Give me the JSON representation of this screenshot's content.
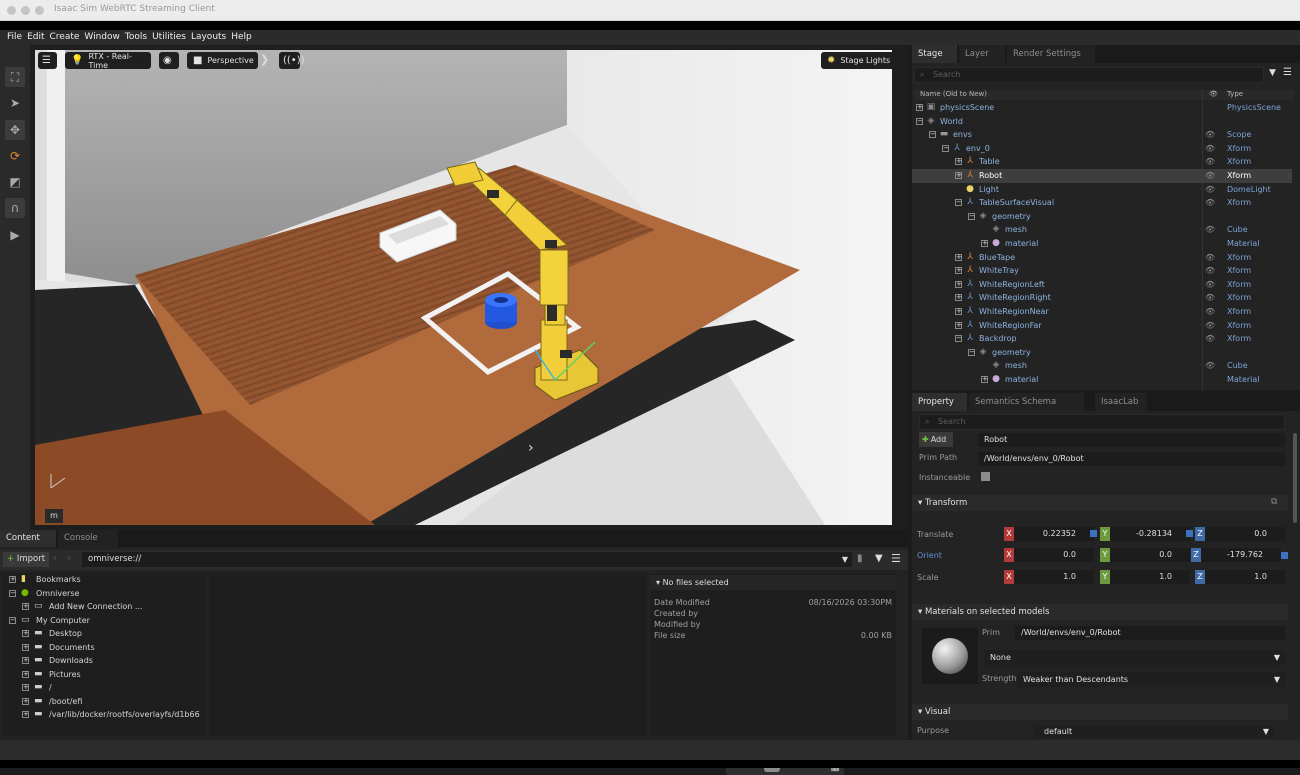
{
  "window": {
    "title": "Isaac Sim WebRTC Streaming Client"
  },
  "menu": [
    "File",
    "Edit",
    "Create",
    "Window",
    "Tools",
    "Utilities",
    "Layouts",
    "Help"
  ],
  "left_toolbar": [
    "select-all-icon",
    "pointer-icon",
    "move-icon",
    "rotate-icon",
    "scale-icon",
    "snap-icon",
    "play-icon"
  ],
  "viewport": {
    "render_mode": "RTX - Real-Time",
    "camera": "Perspective",
    "lights": "Stage Lights",
    "unit_label": "m"
  },
  "stage": {
    "tabs": [
      "Stage",
      "Layer",
      "Render Settings"
    ],
    "search_placeholder": "Search",
    "col_name": "Name (Old to New)",
    "col_type": "Type",
    "rows": [
      {
        "name": "physicsScene",
        "type": "PhysicsScene",
        "eye": "",
        "icon": "▣",
        "icolor": "#8a8a8a",
        "exp": "+"
      },
      {
        "name": "World",
        "type": "",
        "eye": "",
        "icon": "◈",
        "icolor": "#8a8a8a",
        "exp": "−"
      },
      {
        "name": "envs",
        "type": "Scope",
        "eye": "👁",
        "icon": "▬",
        "icolor": "#999",
        "exp": "−"
      },
      {
        "name": "env_0",
        "type": "Xform",
        "eye": "👁",
        "icon": "⅄",
        "icolor": "#6f9ad6",
        "exp": "−"
      },
      {
        "name": "Table",
        "type": "Xform",
        "eye": "👁",
        "icon": "⅄",
        "icolor": "#e3873a",
        "exp": "+"
      },
      {
        "name": "Robot",
        "type": "Xform",
        "eye": "👁",
        "icon": "⅄",
        "icolor": "#e3873a",
        "exp": "+"
      },
      {
        "name": "Light",
        "type": "DomeLight",
        "eye": "👁",
        "icon": "●",
        "icolor": "#e8d26a",
        "exp": ""
      },
      {
        "name": "TableSurfaceVisual",
        "type": "Xform",
        "eye": "👁",
        "icon": "⅄",
        "icolor": "#6f9ad6",
        "exp": "−"
      },
      {
        "name": "geometry",
        "type": "",
        "eye": "",
        "icon": "◈",
        "icolor": "#8a8a8a",
        "exp": "−"
      },
      {
        "name": "mesh",
        "type": "Cube",
        "eye": "👁",
        "icon": "◈",
        "icolor": "#8a8a8a",
        "exp": ""
      },
      {
        "name": "material",
        "type": "Material",
        "eye": "",
        "icon": "●",
        "icolor": "#c8a8d8",
        "exp": "+"
      },
      {
        "name": "BlueTape",
        "type": "Xform",
        "eye": "👁",
        "icon": "⅄",
        "icolor": "#e3873a",
        "exp": "+"
      },
      {
        "name": "WhiteTray",
        "type": "Xform",
        "eye": "👁",
        "icon": "⅄",
        "icolor": "#e3873a",
        "exp": "+"
      },
      {
        "name": "WhiteRegionLeft",
        "type": "Xform",
        "eye": "👁",
        "icon": "⅄",
        "icolor": "#6f9ad6",
        "exp": "+"
      },
      {
        "name": "WhiteRegionRight",
        "type": "Xform",
        "eye": "👁",
        "icon": "⅄",
        "icolor": "#6f9ad6",
        "exp": "+"
      },
      {
        "name": "WhiteRegionNear",
        "type": "Xform",
        "eye": "👁",
        "icon": "⅄",
        "icolor": "#6f9ad6",
        "exp": "+"
      },
      {
        "name": "WhiteRegionFar",
        "type": "Xform",
        "eye": "👁",
        "icon": "⅄",
        "icolor": "#6f9ad6",
        "exp": "+"
      },
      {
        "name": "Backdrop",
        "type": "Xform",
        "eye": "👁",
        "icon": "⅄",
        "icolor": "#6f9ad6",
        "exp": "−"
      },
      {
        "name": "geometry",
        "type": "",
        "eye": "",
        "icon": "◈",
        "icolor": "#8a8a8a",
        "exp": "−"
      },
      {
        "name": "mesh",
        "type": "Cube",
        "eye": "👁",
        "icon": "◈",
        "icolor": "#8a8a8a",
        "exp": ""
      },
      {
        "name": "material",
        "type": "Material",
        "eye": "",
        "icon": "●",
        "icolor": "#c8a8d8",
        "exp": "+"
      }
    ]
  },
  "property": {
    "tabs": [
      "Property",
      "Semantics Schema Editor",
      "IsaacLab"
    ],
    "search_placeholder": "Search",
    "add_label": "Add",
    "prim_name": "Robot",
    "prim_path_label": "Prim Path",
    "prim_path": "/World/envs/env_0/Robot",
    "instanceable_label": "Instanceable",
    "transform_title": "Transform",
    "translate_label": "Translate",
    "orient_label": "Orient",
    "scale_label": "Scale",
    "translate": [
      "0.22352",
      "-0.28134",
      "0.0"
    ],
    "orient": [
      "0.0",
      "0.0",
      "-179.762"
    ],
    "scale": [
      "1.0",
      "1.0",
      "1.0"
    ],
    "axes": [
      "X",
      "Y",
      "Z"
    ],
    "materials_title": "Materials on selected models",
    "mat_prim_label": "Prim",
    "mat_prim": "/World/envs/env_0/Robot",
    "mat_binding": "None",
    "strength_label": "Strength",
    "strength": "Weaker than Descendants",
    "visual_title": "Visual",
    "purpose_label": "Purpose",
    "purpose": "default"
  },
  "content": {
    "tabs": [
      "Content",
      "Console"
    ],
    "import_label": "Import",
    "path": "omniverse://",
    "tree": [
      {
        "name": "Bookmarks",
        "icon": "▮",
        "icolor": "#e8d26a",
        "exp": "+",
        "lvl": 0
      },
      {
        "name": "Omniverse",
        "icon": "●",
        "icolor": "#76b900",
        "exp": "−",
        "lvl": 0
      },
      {
        "name": "Add New Connection ...",
        "icon": "▭",
        "icolor": "#ccc",
        "exp": "+",
        "lvl": 1
      },
      {
        "name": "My Computer",
        "icon": "▭",
        "icolor": "#ccc",
        "exp": "−",
        "lvl": 0
      },
      {
        "name": "Desktop",
        "icon": "▬",
        "icolor": "#ccc",
        "exp": "+",
        "lvl": 1
      },
      {
        "name": "Documents",
        "icon": "▬",
        "icolor": "#ccc",
        "exp": "+",
        "lvl": 1
      },
      {
        "name": "Downloads",
        "icon": "▬",
        "icolor": "#ccc",
        "exp": "+",
        "lvl": 1
      },
      {
        "name": "Pictures",
        "icon": "▬",
        "icolor": "#ccc",
        "exp": "+",
        "lvl": 1
      },
      {
        "name": "/",
        "icon": "▬",
        "icolor": "#ccc",
        "exp": "+",
        "lvl": 1
      },
      {
        "name": "/boot/efi",
        "icon": "▬",
        "icolor": "#ccc",
        "exp": "+",
        "lvl": 1
      },
      {
        "name": "/var/lib/docker/rootfs/overlayfs/d1b66",
        "icon": "▬",
        "icolor": "#ccc",
        "exp": "+",
        "lvl": 1
      }
    ],
    "info_title": "No files selected",
    "date_modified_label": "Date Modified",
    "date_modified": "08/16/2026 03:30PM",
    "created_by_label": "Created by",
    "modified_by_label": "Modified by",
    "file_size_label": "File size",
    "file_size": "0.00 KB"
  }
}
